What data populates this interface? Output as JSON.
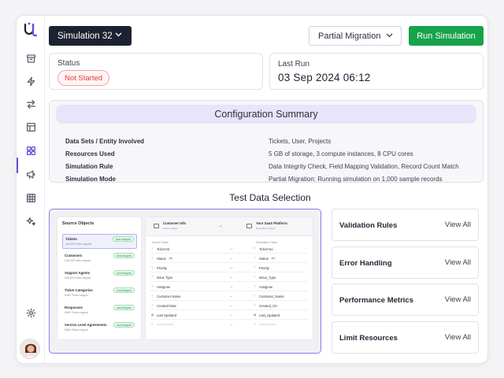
{
  "header": {
    "simulation_label": "Simulation 32",
    "mode_label": "Partial Migration",
    "run_label": "Run Simulation"
  },
  "status": {
    "label": "Status",
    "value": "Not Started",
    "color": "#e23b3b"
  },
  "last_run": {
    "label": "Last Run",
    "value": "03 Sep 2024 06:12"
  },
  "config": {
    "title": "Configuration Summary",
    "rows": [
      {
        "key": "Data Sets / Entity Involved",
        "value": "Tickets, User, Projects"
      },
      {
        "key": "Resources Used",
        "value": "5 GB of storage, 3 compute instances, 8 CPU cores"
      },
      {
        "key": "Simulation Rule",
        "value": "Data Integrity Check, Field Mapping Validation, Record Count Match"
      },
      {
        "key": "Simulation Mode",
        "value": "Partial Migration: Running simulation on 1,000 sample records"
      }
    ]
  },
  "test_data": {
    "title": "Test Data Selection",
    "source_title": "Source Objects",
    "source_items": [
      {
        "name": "Tickets",
        "sub": "100/100 Fields mapped",
        "badge": "Auto-Mapped"
      },
      {
        "name": "Customers",
        "sub": "105/105 Fields mapped",
        "badge": "Auto-Mapped"
      },
      {
        "name": "Support Agents",
        "sub": "523/523 Fields mapped",
        "badge": "Auto-Mapped"
      },
      {
        "name": "Ticket Categories",
        "sub": "80/80 Fields mapped",
        "badge": "Auto-Mapped"
      },
      {
        "name": "Responses",
        "sub": "80/80 Fields mapped",
        "badge": "Auto-Mapped"
      },
      {
        "name": "Service Level Agreements",
        "sub": "80/80 Fields mapped",
        "badge": "Auto-Mapped"
      }
    ],
    "map_left_title": "Customer Info",
    "map_left_sub": "Source Object",
    "map_right_title": "Your SaaS Platform",
    "map_right_sub": "Destination Object",
    "source_fields_label": "Source Fields",
    "dest_fields_label": "Destination Fields",
    "mappings": [
      {
        "src": "Ticket ID",
        "dst": "Ticket No",
        "src_tag": "",
        "dst_tag": ""
      },
      {
        "src": "Status",
        "dst": "Status",
        "src_tag": "PK",
        "dst_tag": "PK"
      },
      {
        "src": "Priority",
        "dst": "Priority",
        "src_tag": "",
        "dst_tag": ""
      },
      {
        "src": "Issue Type",
        "dst": "Issue_Type",
        "src_tag": "",
        "dst_tag": ""
      },
      {
        "src": "Assignee",
        "dst": "Assignee",
        "src_tag": "",
        "dst_tag": ""
      },
      {
        "src": "Customer Name",
        "dst": "Customer_Name",
        "src_tag": "",
        "dst_tag": ""
      },
      {
        "src": "Created Date",
        "dst": "Created_On",
        "src_tag": "",
        "dst_tag": ""
      },
      {
        "src": "Last Updated",
        "dst": "Last_Updated",
        "src_tag": "",
        "dst_tag": ""
      }
    ]
  },
  "panels": [
    {
      "title": "Validation Rules",
      "action": "View All"
    },
    {
      "title": "Error Handling",
      "action": "View All"
    },
    {
      "title": "Performance Metrics",
      "action": "View All"
    },
    {
      "title": "Limit Resources",
      "action": "View All"
    }
  ],
  "sidebar": {
    "icons": [
      "archive-icon",
      "lightning-icon",
      "transfer-icon",
      "layout-icon",
      "grid-icon",
      "megaphone-icon",
      "table-icon",
      "sparkle-icon",
      "settings-icon"
    ],
    "active": "grid-icon"
  },
  "colors": {
    "accent": "#6d4bd8",
    "run_button": "#17a34a",
    "dark_button": "#1d2230"
  }
}
